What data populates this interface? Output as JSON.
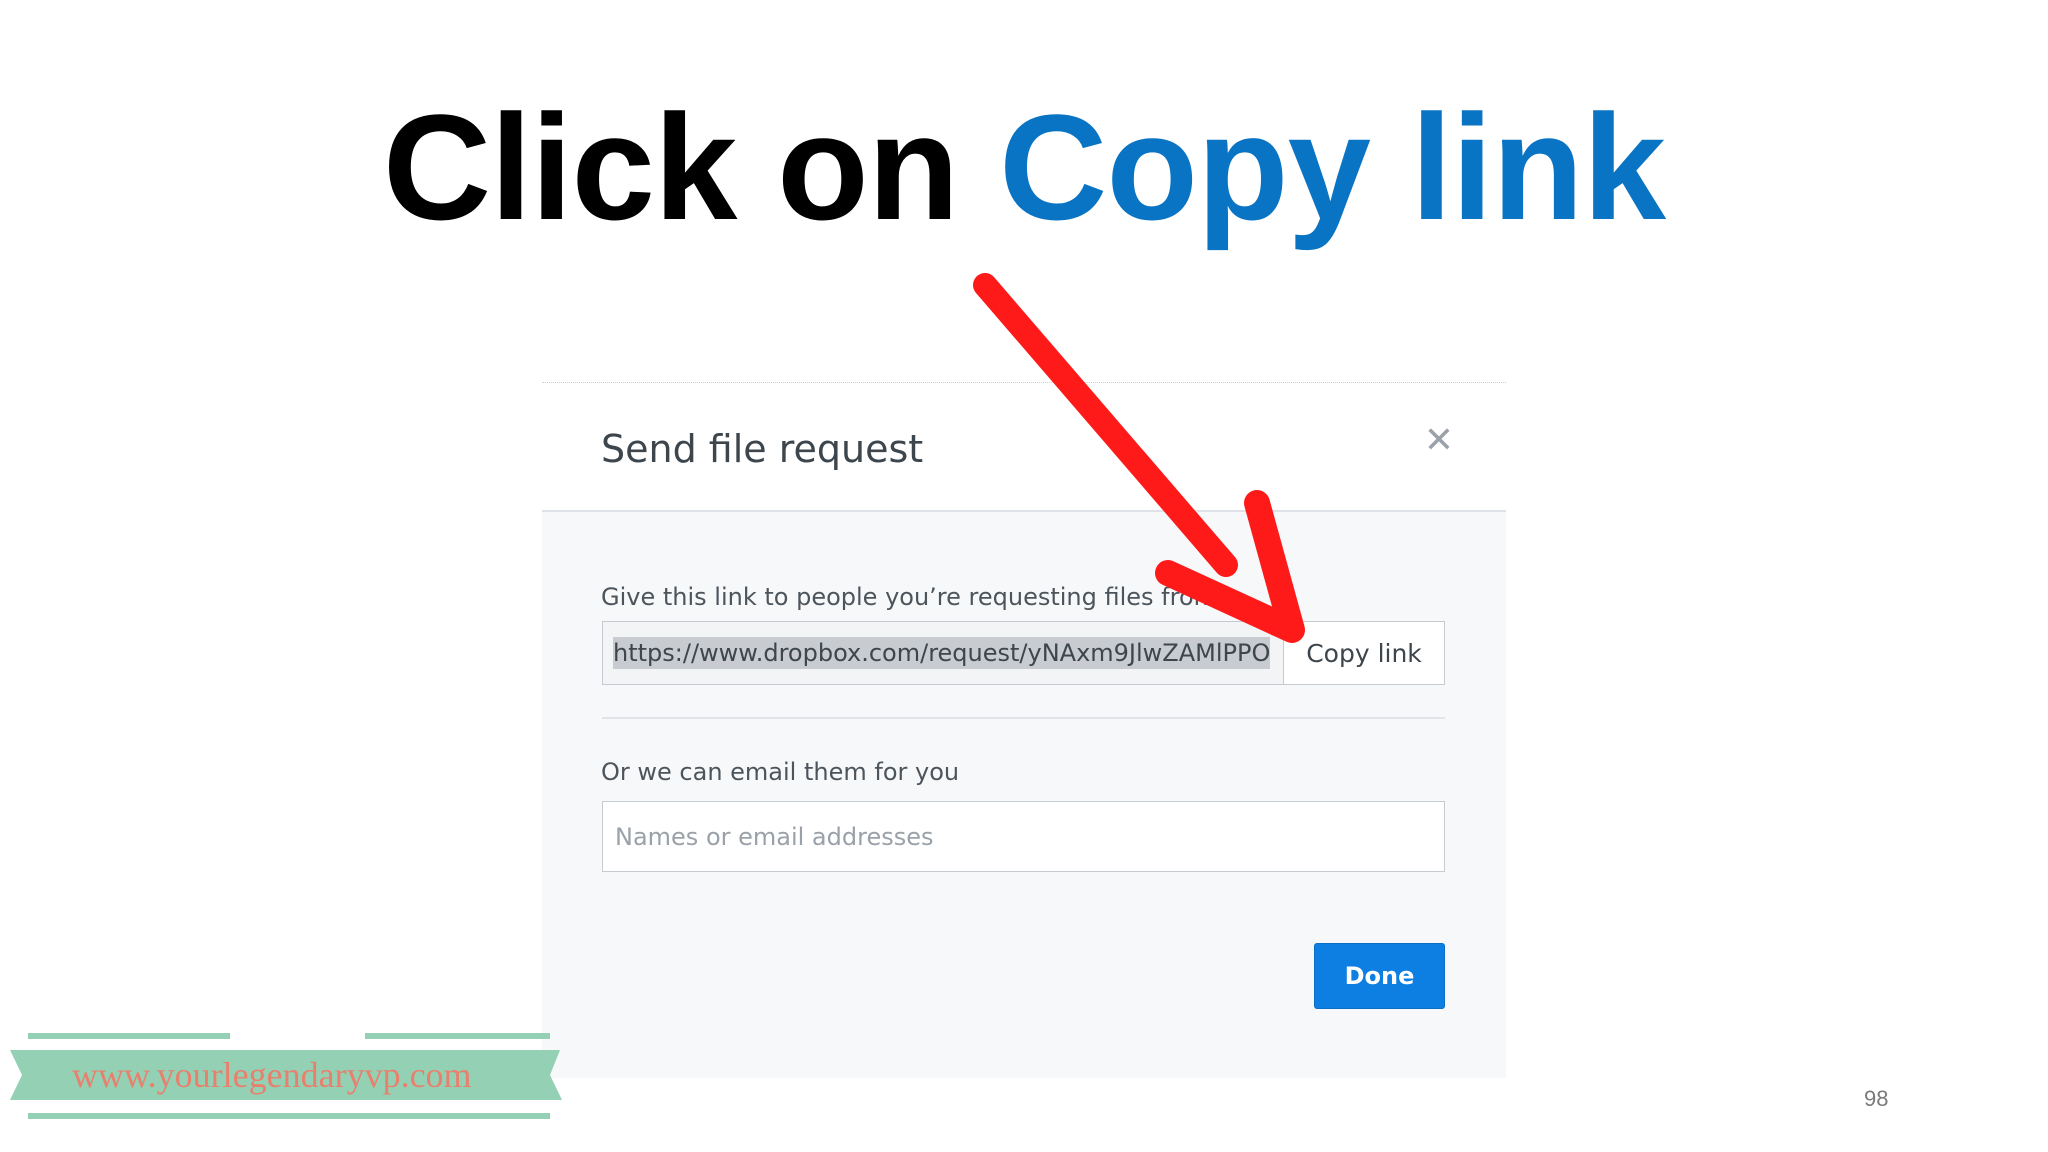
{
  "slide": {
    "title_prefix": "Click on",
    "title_highlight": "Copy link",
    "page_number": "98",
    "website": "www.yourlegendaryvp.com"
  },
  "dialog": {
    "title": "Send file request",
    "close_icon": "close-icon",
    "link_label": "Give this link to people you’re requesting files from",
    "link_value": "https://www.dropbox.com/request/yNAxm9JlwZAMlPPO",
    "copy_label": "Copy link",
    "email_label": "Or we can email them for you",
    "email_placeholder": "Names or email addresses",
    "done_label": "Done"
  },
  "colors": {
    "accent": "#0a74c4",
    "primary_button": "#0d7fe2",
    "arrow": "#ff1a1a",
    "banner": "#94d1b4",
    "banner_text": "#e8806e"
  }
}
